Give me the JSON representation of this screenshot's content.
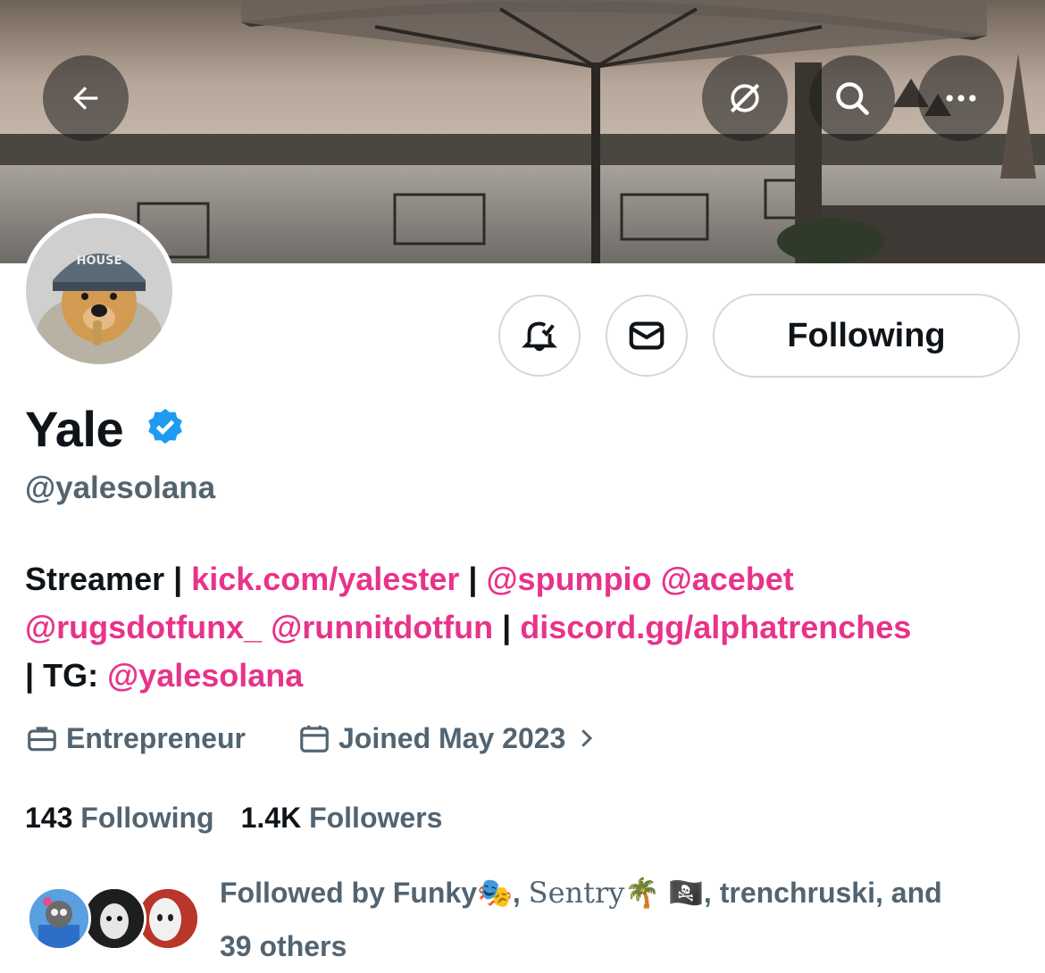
{
  "header": {
    "back_icon": "arrow-left-icon",
    "grok_icon": "grok-icon",
    "search_icon": "search-icon",
    "more_icon": "more-horizontal-icon"
  },
  "actions": {
    "notify_icon": "bell-check-icon",
    "message_icon": "envelope-icon",
    "follow_label": "Following"
  },
  "profile": {
    "name": "Yale",
    "verified_icon": "verified-badge-icon",
    "handle": "@yalesolana",
    "bio": {
      "t1": "Streamer | ",
      "l1": "kick.com/yalester",
      "t2": " | ",
      "l2": "@spumpio",
      "t3": " ",
      "l3": "@acebet",
      "l4": "@rugsdotfunx_",
      "t4": " ",
      "l5": "@runnitdotfun",
      "t5": " | ",
      "l6": "discord.gg/alphatrenches",
      "t6": "| TG: ",
      "l7": "@yalesolana"
    },
    "profession": "Entrepreneur",
    "joined": "Joined May 2023",
    "following_count": "143",
    "following_label": "Following",
    "followers_count": "1.4K",
    "followers_label": "Followers",
    "followed_by": {
      "prefix": "Followed by Funky",
      "emoji1": "🎭",
      "sep1": ", ",
      "name2": "Sentry",
      "emoji2": "🌴 🏴‍☠️",
      "rest": ", trenchruski, and",
      "line2": "39 others"
    }
  },
  "colors": {
    "link": "#e8338a",
    "verified": "#1d9bf0",
    "muted": "#536471"
  }
}
